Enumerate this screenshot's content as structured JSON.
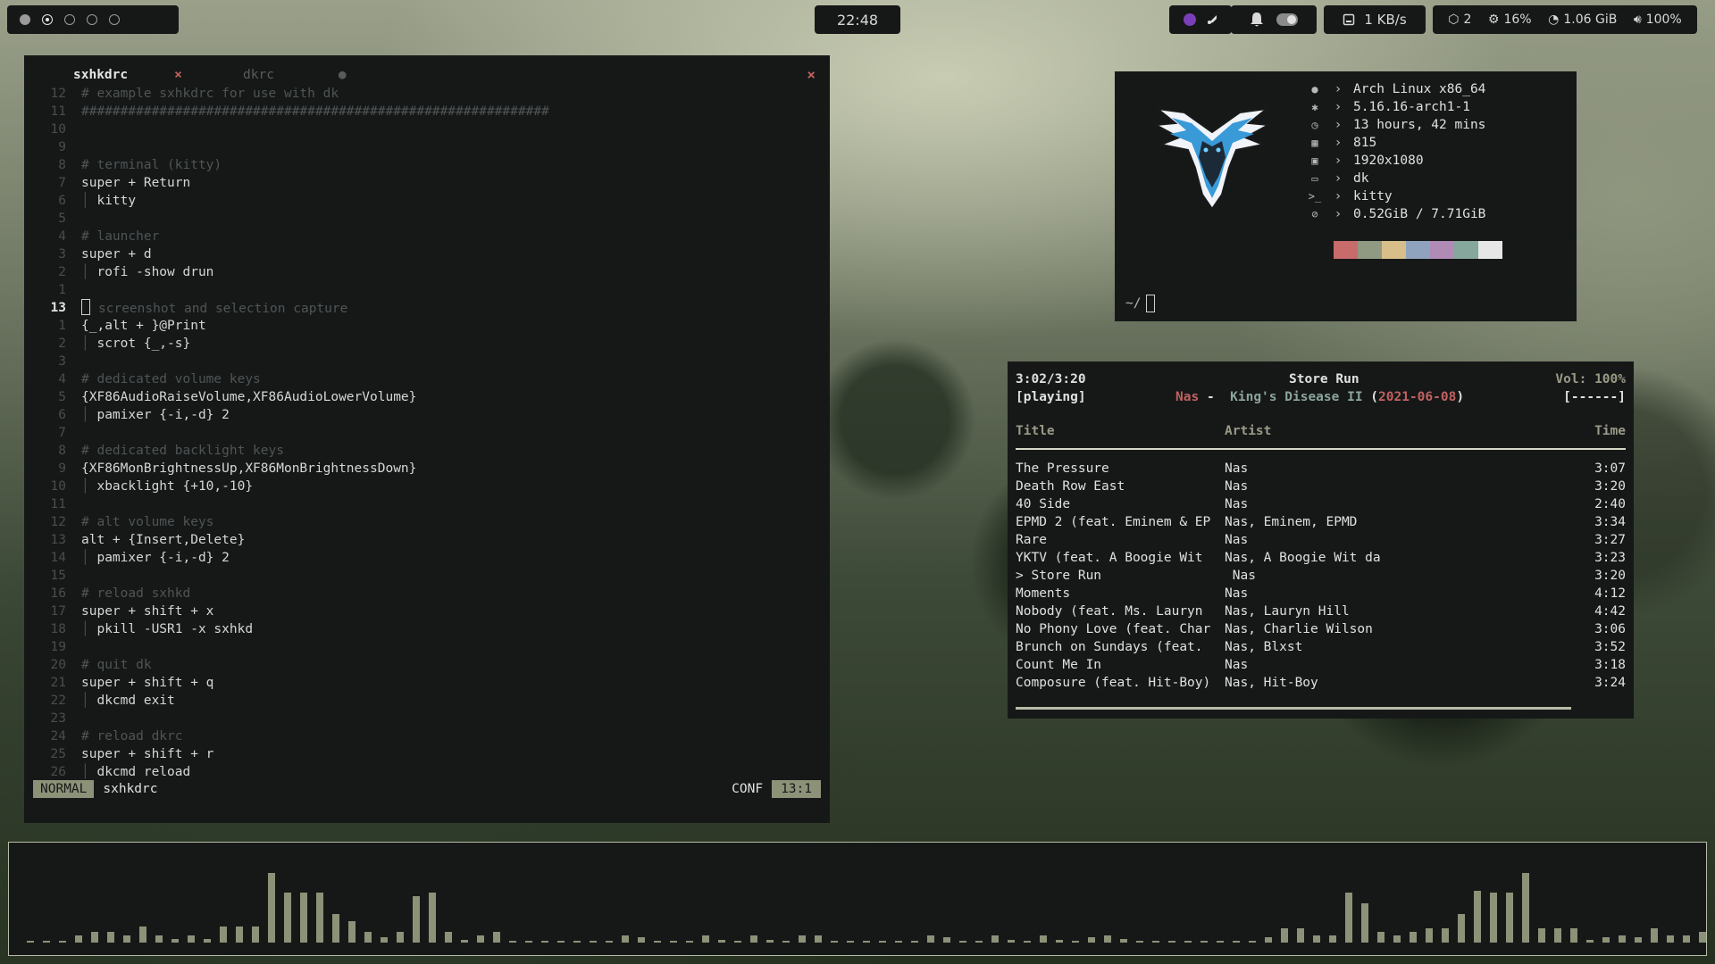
{
  "topbar": {
    "workspaces": [
      "filled",
      "active",
      "empty",
      "empty",
      "empty"
    ],
    "clock": "22:48",
    "net_speed": "1 KB/s",
    "updates": "2",
    "cpu": "16%",
    "memory": "1.06 GiB",
    "volume": "100%"
  },
  "editor": {
    "tabs": [
      {
        "name": "sxhkdrc",
        "close": "×"
      },
      {
        "name": "dkrc",
        "close": "●"
      }
    ],
    "close_glyph": "×",
    "lines": [
      {
        "n": "12",
        "t": "# example sxhkdrc for use with dk",
        "k": "comment"
      },
      {
        "n": "11",
        "t": "############################################################",
        "k": "comment"
      },
      {
        "n": "10",
        "t": "",
        "k": "code"
      },
      {
        "n": "9",
        "t": "",
        "k": "code"
      },
      {
        "n": "8",
        "t": "# terminal (kitty)",
        "k": "comment"
      },
      {
        "n": "7",
        "t": "super + Return",
        "k": "code"
      },
      {
        "n": "6",
        "t": "kitty",
        "k": "indent"
      },
      {
        "n": "5",
        "t": "",
        "k": "code"
      },
      {
        "n": "4",
        "t": "# launcher",
        "k": "comment"
      },
      {
        "n": "3",
        "t": "super + d",
        "k": "code"
      },
      {
        "n": "2",
        "t": "rofi -show drun",
        "k": "indent"
      },
      {
        "n": "1",
        "t": "",
        "k": "code"
      },
      {
        "n": "13",
        "t": "screenshot and selection capture",
        "k": "cursor"
      },
      {
        "n": "1",
        "t": "{_,alt + }@Print",
        "k": "code"
      },
      {
        "n": "2",
        "t": "scrot {_,-s}",
        "k": "indent"
      },
      {
        "n": "3",
        "t": "",
        "k": "code"
      },
      {
        "n": "4",
        "t": "# dedicated volume keys",
        "k": "comment"
      },
      {
        "n": "5",
        "t": "{XF86AudioRaiseVolume,XF86AudioLowerVolume}",
        "k": "code"
      },
      {
        "n": "6",
        "t": "pamixer {-i,-d} 2",
        "k": "indent"
      },
      {
        "n": "7",
        "t": "",
        "k": "code"
      },
      {
        "n": "8",
        "t": "# dedicated backlight keys",
        "k": "comment"
      },
      {
        "n": "9",
        "t": "{XF86MonBrightnessUp,XF86MonBrightnessDown}",
        "k": "code"
      },
      {
        "n": "10",
        "t": "xbacklight {+10,-10}",
        "k": "indent"
      },
      {
        "n": "11",
        "t": "",
        "k": "code"
      },
      {
        "n": "12",
        "t": "# alt volume keys",
        "k": "comment"
      },
      {
        "n": "13",
        "t": "alt + {Insert,Delete}",
        "k": "code"
      },
      {
        "n": "14",
        "t": "pamixer {-i,-d} 2",
        "k": "indent"
      },
      {
        "n": "15",
        "t": "",
        "k": "code"
      },
      {
        "n": "16",
        "t": "# reload sxhkd",
        "k": "comment"
      },
      {
        "n": "17",
        "t": "super + shift + x",
        "k": "code"
      },
      {
        "n": "18",
        "t": "pkill -USR1 -x sxhkd",
        "k": "indent"
      },
      {
        "n": "19",
        "t": "",
        "k": "code"
      },
      {
        "n": "20",
        "t": "# quit dk",
        "k": "comment"
      },
      {
        "n": "21",
        "t": "super + shift + q",
        "k": "code"
      },
      {
        "n": "22",
        "t": "dkcmd exit",
        "k": "indent"
      },
      {
        "n": "23",
        "t": "",
        "k": "code"
      },
      {
        "n": "24",
        "t": "# reload dkrc",
        "k": "comment"
      },
      {
        "n": "25",
        "t": "super + shift + r",
        "k": "code"
      },
      {
        "n": "26",
        "t": "dkcmd reload",
        "k": "indent"
      }
    ],
    "status": {
      "mode": "NORMAL",
      "file": "sxhkdrc",
      "filetype": "CONF",
      "position": "13:1"
    }
  },
  "neofetch": {
    "rows": [
      {
        "icon": "user-icon",
        "glyph": "●",
        "value": "Arch Linux x86_64"
      },
      {
        "icon": "gear-icon",
        "glyph": "✱",
        "value": "5.16.16-arch1-1"
      },
      {
        "icon": "clock-icon",
        "glyph": "◷",
        "value": "13 hours, 42 mins"
      },
      {
        "icon": "package-icon",
        "glyph": "▦",
        "value": "815"
      },
      {
        "icon": "image-icon",
        "glyph": "▣",
        "value": "1920x1080"
      },
      {
        "icon": "monitor-icon",
        "glyph": "▭",
        "value": "dk"
      },
      {
        "icon": "terminal-icon",
        "glyph": ">_",
        "value": "kitty"
      },
      {
        "icon": "memory-icon",
        "glyph": "⊘",
        "value": "0.52GiB / 7.71GiB"
      }
    ],
    "arrow": "›",
    "palette": [
      "#c76b6b",
      "#909a82",
      "#d8bf8a",
      "#8fa3bf",
      "#b08bb6",
      "#86a79b",
      "#e6e6e6"
    ],
    "prompt": "~/"
  },
  "music": {
    "elapsed": "3:02/3:20",
    "state": "[playing]",
    "song": "Store Run",
    "artist": "Nas",
    "dash": "-",
    "album": "King's Disease II",
    "date": "2021-06-08",
    "volume": "Vol: 100%",
    "flags": "[------]",
    "columns": {
      "title": "Title",
      "artist": "Artist",
      "time": "Time"
    },
    "tracks": [
      {
        "title": "The Pressure",
        "artist": "Nas",
        "time": "3:07"
      },
      {
        "title": "Death Row East",
        "artist": "Nas",
        "time": "3:20"
      },
      {
        "title": "40 Side",
        "artist": "Nas",
        "time": "2:40"
      },
      {
        "title": "EPMD 2 (feat. Eminem & EP",
        "artist": "Nas, Eminem, EPMD",
        "time": "3:34"
      },
      {
        "title": "Rare",
        "artist": "Nas",
        "time": "3:27"
      },
      {
        "title": "YKTV (feat. A Boogie Wit",
        "artist": "Nas, A Boogie Wit da",
        "time": "3:23"
      },
      {
        "title": "> Store Run",
        "artist": " Nas",
        "time": "3:20"
      },
      {
        "title": "Moments",
        "artist": "Nas",
        "time": "4:12"
      },
      {
        "title": "Nobody (feat. Ms. Lauryn",
        "artist": "Nas, Lauryn Hill",
        "time": "4:42"
      },
      {
        "title": "No Phony Love (feat. Char",
        "artist": "Nas, Charlie Wilson",
        "time": "3:06"
      },
      {
        "title": "Brunch on Sundays (feat.",
        "artist": "Nas, Blxst",
        "time": "3:52"
      },
      {
        "title": "Count Me In",
        "artist": "Nas",
        "time": "3:18"
      },
      {
        "title": "Composure (feat. Hit-Boy)",
        "artist": "Nas, Hit-Boy",
        "time": "3:24"
      }
    ],
    "progress_fraction": 0.91
  },
  "visualizer": {
    "levels": [
      0.01,
      0.01,
      0.01,
      0.08,
      0.12,
      0.12,
      0.08,
      0.18,
      0.08,
      0.04,
      0.08,
      0.04,
      0.18,
      0.18,
      0.18,
      0.78,
      0.56,
      0.56,
      0.56,
      0.32,
      0.24,
      0.12,
      0.06,
      0.12,
      0.52,
      0.56,
      0.12,
      0.03,
      0.08,
      0.12,
      0.01,
      0.01,
      0.01,
      0.01,
      0.01,
      0.01,
      0.01,
      0.08,
      0.06,
      0.01,
      0.01,
      0.01,
      0.08,
      0.03,
      0.01,
      0.08,
      0.03,
      0.01,
      0.08,
      0.08,
      0.01,
      0.01,
      0.01,
      0.01,
      0.01,
      0.01,
      0.08,
      0.06,
      0.01,
      0.01,
      0.08,
      0.03,
      0.01,
      0.08,
      0.03,
      0.01,
      0.06,
      0.08,
      0.04,
      0.01,
      0.01,
      0.01,
      0.01,
      0.01,
      0.01,
      0.01,
      0.01,
      0.06,
      0.16,
      0.16,
      0.08,
      0.08,
      0.56,
      0.44,
      0.12,
      0.08,
      0.12,
      0.16,
      0.16,
      0.32,
      0.58,
      0.56,
      0.56,
      0.78,
      0.16,
      0.16,
      0.16,
      0.03,
      0.06,
      0.08,
      0.06,
      0.16,
      0.08,
      0.08,
      0.12,
      0.08,
      0.03,
      0.01,
      0.01,
      0.01,
      0.01
    ],
    "bar_color": "#8b9278"
  }
}
